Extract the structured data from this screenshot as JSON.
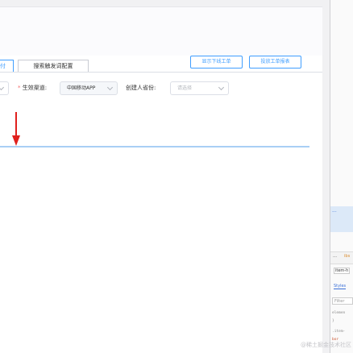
{
  "tabs": [
    {
      "label": "付",
      "active": true
    },
    {
      "label": "搜索触发词配置",
      "active": false
    }
  ],
  "header_buttons": {
    "show_workorder": "显示下线工单",
    "workorder_report": "投放工单报表"
  },
  "filters": {
    "channel_label": "生效渠道:",
    "channel_value": "中国移动APP",
    "creator_label": "创建人省份:",
    "creator_placeholder": "请选择"
  },
  "devtools": {
    "dots": "...",
    "panel_tab_fragment": "ibs",
    "breadcrumb": "item-h",
    "styles_tab": "Styles",
    "filter_placeholder": "Filter",
    "code_1": "elemen",
    "code_2": "}",
    "code_3": ".item-",
    "code_4": "bor"
  },
  "watermark": "@稀土掘金技术社区",
  "colors": {
    "accent": "#409eff",
    "arrow": "#e0201d",
    "required": "#f56c6c"
  }
}
